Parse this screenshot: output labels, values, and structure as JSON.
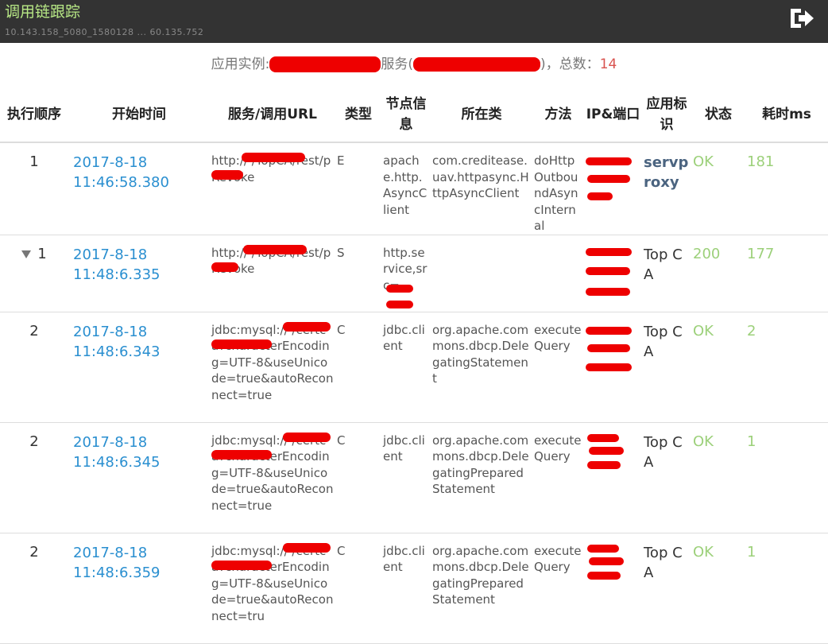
{
  "header": {
    "title": "调用链跟踪",
    "subtitle": "10.143.158_5080_1580128 ... 60.135.752",
    "logout_icon": "logout-icon"
  },
  "summary": {
    "prefix": "应用实例:",
    "service_label": "服务(",
    "service_close": ")",
    "total_label": "，总数：",
    "total": "14"
  },
  "table": {
    "headers": {
      "seq": "执行顺序",
      "start": "开始时间",
      "url": "服务/调用URL",
      "type": "类型",
      "node": "节点信息",
      "class": "所在类",
      "method": "方法",
      "ip": "IP&端口",
      "app": "应用标识",
      "status": "状态",
      "cost": "耗时ms"
    },
    "rows": [
      {
        "seq": "1",
        "date": "2017-8-18",
        "time": "11:46:58.380",
        "url": "http:// /TopCA/rest/pRevoke",
        "type": "E",
        "node": "apache.http.AsyncClient",
        "class": "com.creditease.uav.httpasync.HttpAsyncClient",
        "method": "doHttpOutboundAsyncInternal",
        "ip": "",
        "app": "servproxy",
        "status": "OK",
        "cost": "181"
      },
      {
        "seq": "1",
        "date": "2017-8-18",
        "time": "11:48:6.335",
        "url": "http:// /TopCA/rest/pRevoke",
        "type": "S",
        "node": "http.service,src=",
        "class": "",
        "method": "",
        "ip": "",
        "app": "Top CA",
        "status": "200",
        "cost": "177"
      },
      {
        "seq": "2",
        "date": "2017-8-18",
        "time": "11:48:6.343",
        "url": "jdbc:mysql:// /certca?characterEncoding=UTF-8&useUnicode=true&autoReconnect=true",
        "type": "C",
        "node": "jdbc.client",
        "class": "org.apache.commons.dbcp.DelegatingStatement",
        "method": "executeQuery",
        "ip": "",
        "app": "Top CA",
        "status": "OK",
        "cost": "2"
      },
      {
        "seq": "2",
        "date": "2017-8-18",
        "time": "11:48:6.345",
        "url": "jdbc:mysql:// /certca?characterEncoding=UTF-8&useUnicode=true&autoReconnect=true",
        "type": "C",
        "node": "jdbc.client",
        "class": "org.apache.commons.dbcp.DelegatingPreparedStatement",
        "method": "executeQuery",
        "ip": "",
        "app": "Top CA",
        "status": "OK",
        "cost": "1"
      },
      {
        "seq": "2",
        "date": "2017-8-18",
        "time": "11:48:6.359",
        "url": "jdbc:mysql:// /certca?characterEncoding=UTF-8&useUnicode=true&autoReconnect=tru",
        "type": "C",
        "node": "jdbc.client",
        "class": "org.apache.commons.dbcp.DelegatingPreparedStatement",
        "method": "executeQuery",
        "ip": "",
        "app": "Top CA",
        "status": "OK",
        "cost": "1"
      }
    ]
  }
}
